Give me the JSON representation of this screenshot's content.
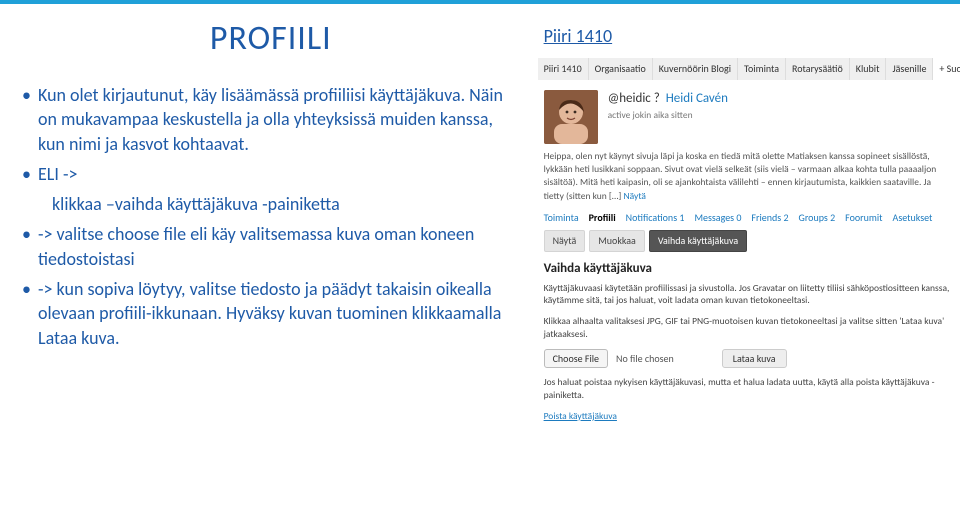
{
  "title": "PROFIILI",
  "bullets": {
    "b1": "Kun olet kirjautunut, käy lisäämässä profiiliisi käyttäjäkuva. Näin on mukavampaa keskustella ja olla yhteyksissä muiden kanssa, kun nimi ja kasvot kohtaavat.",
    "b2": "ELI ->",
    "b2a": "klikkaa –vaihda käyttäjäkuva -painiketta",
    "b3": "-> valitse choose file eli käy valitsemassa kuva oman koneen tiedostoistasi",
    "b4": "-> kun sopiva löytyy, valitse tiedosto ja päädyt takaisin oikealla olevaan profiili-ikkunaan. Hyväksy kuvan tuominen klikkaamalla Lataa kuva."
  },
  "shot": {
    "brand": "Piiri 1410",
    "tabs": [
      "Piiri 1410",
      "Organisaatio",
      "Kuvernöörin Blogi",
      "Toiminta",
      "Rotarysäätiö",
      "Klubit",
      "Jäsenille",
      "+ Suo"
    ],
    "tabs_plus_idx": 7,
    "handle_at": "@heidic",
    "handle_q": "?",
    "handle_name": "Heidi Cavén",
    "activity": "active jokin aika sitten",
    "blurb_1": "Heippa, olen nyt käynyt sivuja läpi ja koska en tiedä mitä olette Matiaksen kanssa sopineet sisällöstä, lykkään heti lusikkani soppaan. Sivut ovat vielä selkeät (siis vielä – varmaan alkaa kohta tulla paaaaljon sisältöä). Mitä heti kaipasin, oli se ajankohtaista välilehti – ennen kirjautumista, kaikkien saataville. Ja tietty (sitten kun […] ",
    "blurb_more": "Näytä",
    "subtabs": [
      {
        "label": "Toiminta"
      },
      {
        "label": "Profiili",
        "active": true
      },
      {
        "label": "Notifications 1"
      },
      {
        "label": "Messages 0"
      },
      {
        "label": "Friends 2"
      },
      {
        "label": "Groups 2"
      },
      {
        "label": "Foorumit"
      },
      {
        "label": "Asetukset"
      }
    ],
    "btns": {
      "view": "Näytä",
      "edit": "Muokkaa",
      "change": "Vaihda käyttäjäkuva"
    },
    "section": "Vaihda käyttäjäkuva",
    "help1": "Käyttäjäkuvaasi käytetään profiilissasi ja sivustolla. Jos Gravatar on liitetty tiliisi sähköpostiositteen kanssa, käytämme sitä, tai jos haluat, voit ladata oman kuvan tietokoneeltasi.",
    "help2": "Klikkaa alhaalta valitaksesi JPG, GIF tai PNG-muotoisen kuvan tietokoneeltasi ja valitse sitten 'Lataa kuva' jatkaaksesi.",
    "choose": "Choose File",
    "nofile": "No file chosen",
    "upload": "Lataa kuva",
    "help3": "Jos haluat poistaa nykyisen käyttäjäkuvasi, mutta et halua ladata uutta, käytä alla poista käyttäjäkuva -painiketta.",
    "delete": "Poista käyttäjäkuva"
  }
}
